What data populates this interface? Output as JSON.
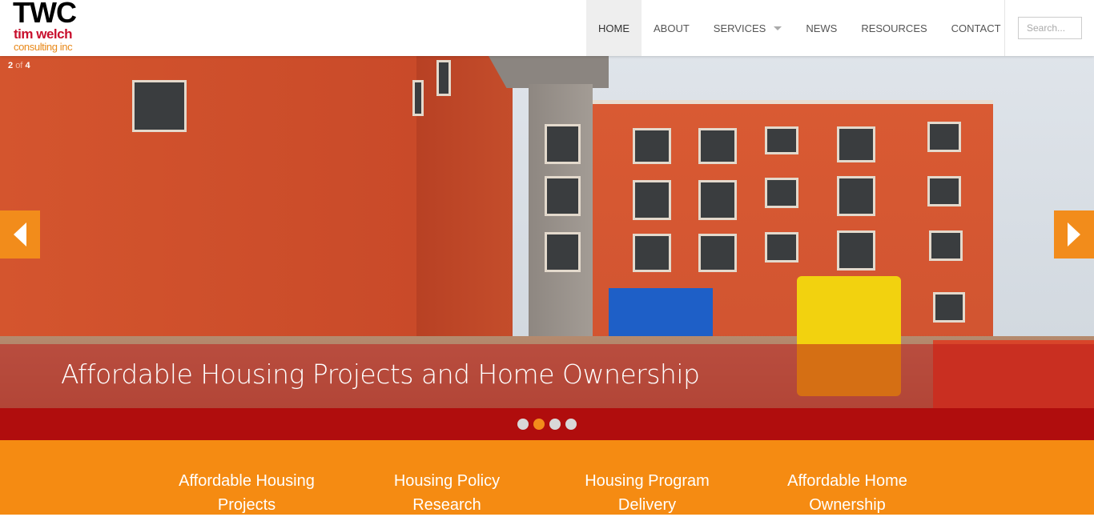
{
  "logo": {
    "main": "TWC",
    "line1": "tim welch",
    "line2": "consulting inc"
  },
  "nav": {
    "items": [
      {
        "label": "HOME",
        "active": true
      },
      {
        "label": "ABOUT",
        "active": false
      },
      {
        "label": "SERVICES",
        "active": false,
        "dropdown": true
      },
      {
        "label": "NEWS",
        "active": false
      },
      {
        "label": "RESOURCES",
        "active": false
      },
      {
        "label": "CONTACT",
        "active": false
      }
    ],
    "search_placeholder": "Search..."
  },
  "slider": {
    "current": "2",
    "of": "of",
    "total": "4",
    "caption": "Affordable Housing Projects and Home Ownership",
    "active_dot": 2,
    "dot_count": 4,
    "prev_icon": "arrow-left-icon",
    "next_icon": "arrow-right-icon"
  },
  "services": [
    {
      "line1": "Affordable Housing",
      "line2": "Projects"
    },
    {
      "line1": "Housing Policy",
      "line2": "Research"
    },
    {
      "line1": "Housing Program",
      "line2": "Delivery"
    },
    {
      "line1": "Affordable Home",
      "line2": "Ownership"
    }
  ],
  "colors": {
    "accent_orange": "#f58b12",
    "dots_bar_red": "#b00d0d",
    "logo_red": "#c8102e"
  }
}
